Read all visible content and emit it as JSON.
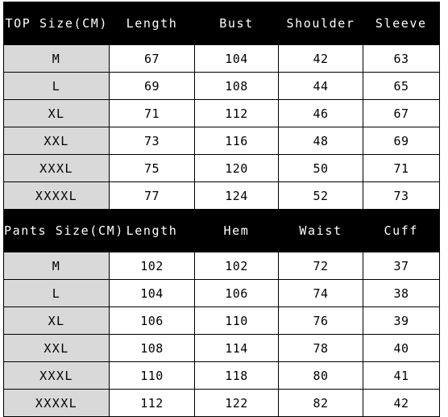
{
  "tables": [
    {
      "name": "top-size-table",
      "headers": [
        "TOP Size(CM)",
        "Length",
        "Bust",
        "Shoulder",
        "Sleeve"
      ],
      "rows": [
        [
          "M",
          "67",
          "104",
          "42",
          "63"
        ],
        [
          "L",
          "69",
          "108",
          "44",
          "65"
        ],
        [
          "XL",
          "71",
          "112",
          "46",
          "67"
        ],
        [
          "XXL",
          "73",
          "116",
          "48",
          "69"
        ],
        [
          "XXXL",
          "75",
          "120",
          "50",
          "71"
        ],
        [
          "XXXXL",
          "77",
          "124",
          "52",
          "73"
        ]
      ]
    },
    {
      "name": "pants-size-table",
      "headers": [
        "Pants Size(CM)",
        "Length",
        "Hem",
        "Waist",
        "Cuff"
      ],
      "rows": [
        [
          "M",
          "102",
          "102",
          "72",
          "37"
        ],
        [
          "L",
          "104",
          "106",
          "74",
          "38"
        ],
        [
          "XL",
          "106",
          "110",
          "76",
          "39"
        ],
        [
          "XXL",
          "108",
          "114",
          "78",
          "40"
        ],
        [
          "XXXL",
          "110",
          "118",
          "80",
          "41"
        ],
        [
          "XXXXL",
          "112",
          "122",
          "82",
          "42"
        ]
      ]
    }
  ],
  "colors": {
    "header_background": "#000000",
    "header_text": "#ffffff",
    "size_column_background": "#d9d9d9",
    "cell_background": "#ffffff",
    "border": "#000000"
  }
}
